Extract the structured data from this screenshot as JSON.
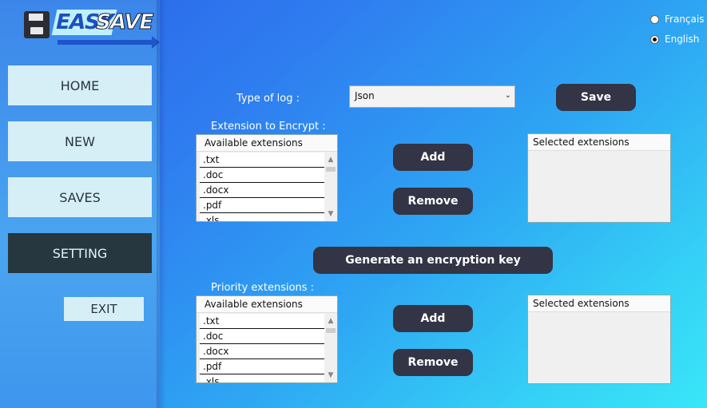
{
  "logo": {
    "word1": "EASY",
    "word2": "SAVE"
  },
  "nav": {
    "home": "HOME",
    "new": "NEW",
    "saves": "SAVES",
    "setting": "SETTING",
    "exit": "EXIT"
  },
  "language": {
    "options": [
      "Français",
      "English"
    ],
    "selected": "English"
  },
  "log": {
    "label": "Type of log :",
    "selected": "Json",
    "save_label": "Save"
  },
  "encrypt": {
    "label": "Extension to Encrypt :",
    "available_header": "Available extensions",
    "available": [
      ".txt",
      ".doc",
      ".docx",
      ".pdf",
      ".xls"
    ],
    "selected_header": "Selected extensions",
    "add_label": "Add",
    "remove_label": "Remove"
  },
  "generate_key_label": "Generate an encryption key",
  "priority": {
    "label": "Priority extensions :",
    "available_header": "Available extensions",
    "available": [
      ".txt",
      ".doc",
      ".docx",
      ".pdf",
      ".xls"
    ],
    "selected_header": "Selected extensions",
    "add_label": "Add",
    "remove_label": "Remove"
  },
  "colors": {
    "sidebar_button": "#d6eff7",
    "active_button": "#27373f",
    "dark_button": "#333446"
  },
  "icons": {
    "logo": "floppy-disk-icon",
    "dropdown": "chevron-down-icon",
    "scroll_up": "chevron-up-icon",
    "scroll_down": "chevron-down-icon"
  }
}
